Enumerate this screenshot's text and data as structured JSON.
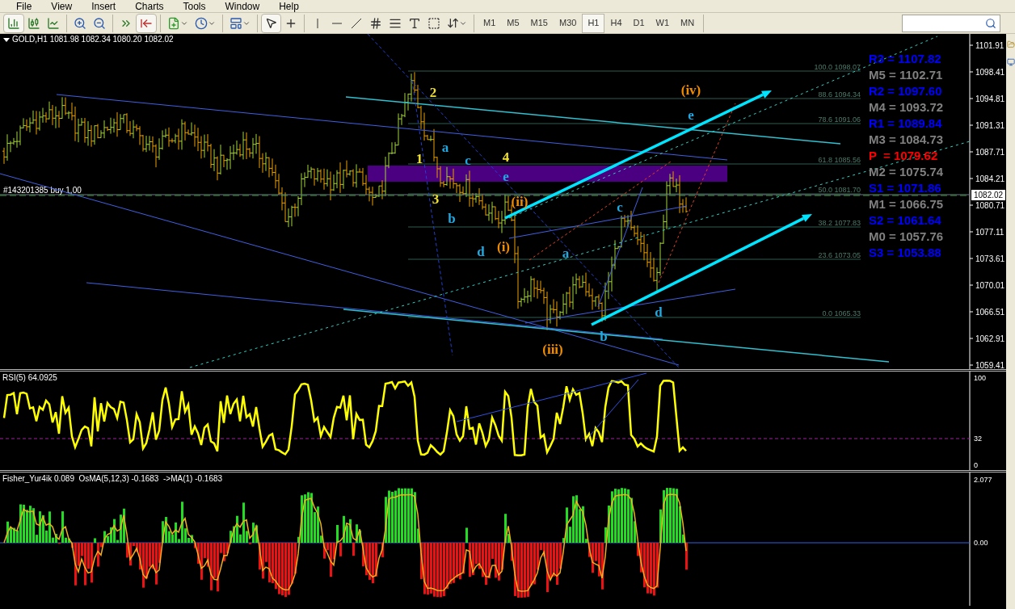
{
  "menu": [
    "File",
    "View",
    "Insert",
    "Charts",
    "Tools",
    "Window",
    "Help"
  ],
  "timeframes": [
    {
      "label": "M1",
      "selected": false
    },
    {
      "label": "M5",
      "selected": false
    },
    {
      "label": "M15",
      "selected": false
    },
    {
      "label": "M30",
      "selected": false
    },
    {
      "label": "H1",
      "selected": true
    },
    {
      "label": "H4",
      "selected": false
    },
    {
      "label": "D1",
      "selected": false
    },
    {
      "label": "W1",
      "selected": false
    },
    {
      "label": "MN",
      "selected": false
    }
  ],
  "chart": {
    "header": "GOLD,H1 1081.98 1082.34 1080.20 1082.02",
    "order_label": "#143201385 buy 1,00",
    "current_price": "1082.02",
    "price_axis": [
      "1101.91",
      "1098.41",
      "1094.81",
      "1091.31",
      "1087.71",
      "1084.21",
      "1080.71",
      "1077.11",
      "1073.61",
      "1070.01",
      "1066.51",
      "1062.91",
      "1059.41"
    ],
    "fib_levels": [
      {
        "label": "100.0 1098.07"
      },
      {
        "label": "88.6 1094.34"
      },
      {
        "label": "78.6 1091.06"
      },
      {
        "label": "61.8 1085.56"
      },
      {
        "label": "50.0 1081.70"
      },
      {
        "label": "38.2 1077.83"
      },
      {
        "label": "23.6 1073.05"
      },
      {
        "label": "0.0 1065.33"
      }
    ],
    "pivots": [
      {
        "label": "R3 = 1107.82",
        "color": "#0000ff"
      },
      {
        "label": "M5 = 1102.71",
        "color": "#808080"
      },
      {
        "label": "R2 = 1097.60",
        "color": "#0000ff"
      },
      {
        "label": "M4 = 1093.72",
        "color": "#808080"
      },
      {
        "label": "R1 = 1089.84",
        "color": "#0000ff"
      },
      {
        "label": "M3 = 1084.73",
        "color": "#808080"
      },
      {
        "label": "P  = 1079.62",
        "color": "#ff0000"
      },
      {
        "label": "M2 = 1075.74",
        "color": "#808080"
      },
      {
        "label": "S1 = 1071.86",
        "color": "#0000ff"
      },
      {
        "label": "M1 = 1066.75",
        "color": "#808080"
      },
      {
        "label": "S2 = 1061.64",
        "color": "#0000ff"
      },
      {
        "label": "M0 = 1057.76",
        "color": "#808080"
      },
      {
        "label": "S3 = 1053.88",
        "color": "#0000ff"
      }
    ],
    "wave_labels": [
      {
        "text": "2",
        "color": "#f0e030"
      },
      {
        "text": "1",
        "color": "#f0e030"
      },
      {
        "text": "a",
        "color": "#20a8e0"
      },
      {
        "text": "c",
        "color": "#20a8e0"
      },
      {
        "text": "4",
        "color": "#f0e030"
      },
      {
        "text": "e",
        "color": "#20a8e0"
      },
      {
        "text": "3",
        "color": "#f0e030"
      },
      {
        "text": "b",
        "color": "#20a8e0"
      },
      {
        "text": "(ii)",
        "color": "#f08c00"
      },
      {
        "text": "d",
        "color": "#20a8e0"
      },
      {
        "text": "(i)",
        "color": "#f08c00"
      },
      {
        "text": "a",
        "color": "#20a8e0"
      },
      {
        "text": "c",
        "color": "#20a8e0"
      },
      {
        "text": "(iv)",
        "color": "#f08c00"
      },
      {
        "text": "e",
        "color": "#20a8e0"
      },
      {
        "text": "(iii)",
        "color": "#f08c00"
      },
      {
        "text": "b",
        "color": "#20a8e0"
      },
      {
        "text": "d",
        "color": "#20a8e0"
      }
    ]
  },
  "rsi": {
    "header": "RSI(5) 64.0925",
    "axis": [
      "100",
      "32",
      "0"
    ]
  },
  "fisher": {
    "header": "Fisher_Yur4ik 0.089  OsMA(5,12,3) -0.1683  ->MA(1) -0.1683",
    "axis": [
      "2.077",
      "0.00"
    ]
  }
}
